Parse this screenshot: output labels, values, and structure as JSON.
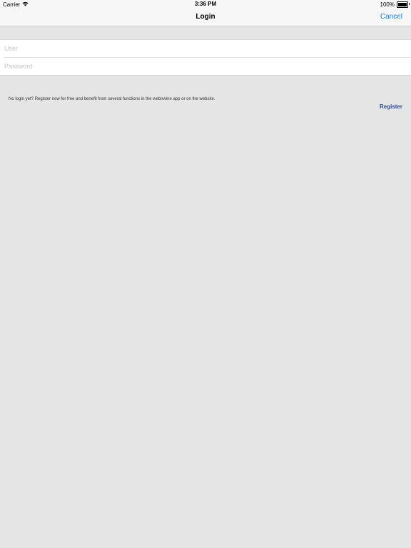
{
  "status_bar": {
    "carrier": "Carrier",
    "time": "3:36 PM",
    "battery": "100%",
    "battery_level": 1.0,
    "wifi_icon": "wifi-icon",
    "battery_icon": "battery-icon"
  },
  "nav": {
    "title": "Login",
    "cancel_label": "Cancel"
  },
  "form": {
    "user_placeholder": "User",
    "user_value": "",
    "password_placeholder": "Password",
    "password_value": ""
  },
  "info": {
    "text": "No login yet? Register now for free and benefit from several functions in the webnwine app or on the website.",
    "register_label": "Register"
  },
  "colors": {
    "accent": "#1a7cf5",
    "register": "#2b4f8f",
    "background": "#e5e5e5",
    "bar_background": "#f7f7f7"
  }
}
